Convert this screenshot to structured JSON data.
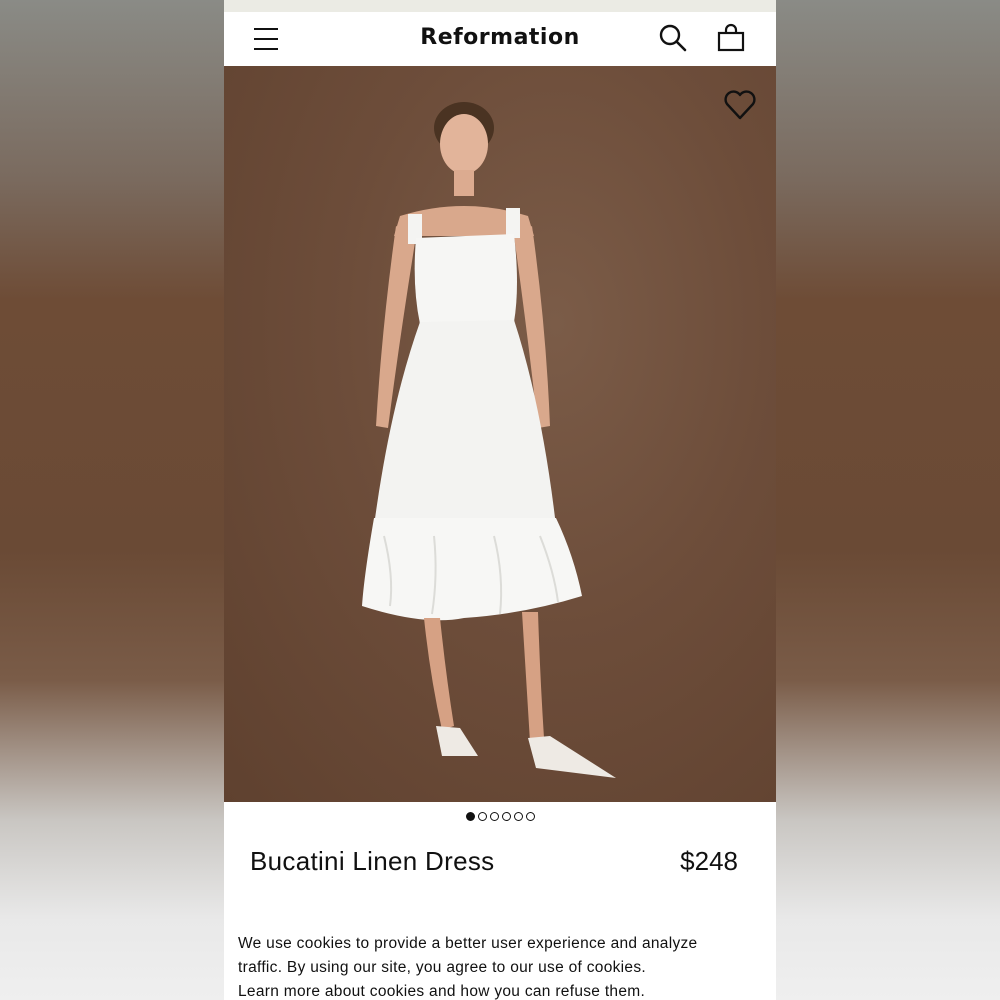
{
  "header": {
    "brand": "Reformation",
    "menu_icon": "hamburger-menu-icon",
    "search_icon": "search-icon",
    "bag_icon": "shopping-bag-icon"
  },
  "gallery": {
    "wishlist_icon": "heart-icon",
    "image_count": 6,
    "active_index": 0,
    "background_color": "#6d4d3a"
  },
  "product": {
    "name": "Bucatini Linen Dress",
    "price": "$248"
  },
  "cookie_banner": {
    "line1": "We use cookies to provide a better user experience and analyze",
    "line2": "traffic. By using our site, you agree to our use of cookies.",
    "line3": "Learn more about cookies and how you can refuse them."
  }
}
